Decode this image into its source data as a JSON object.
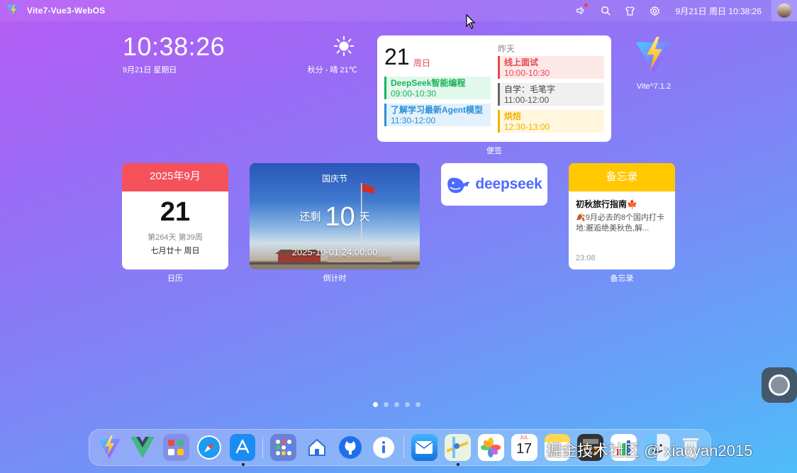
{
  "topbar": {
    "title": "Vite7-Vue3-WebOS",
    "datetime": "9月21日 周日 10:38:26",
    "icons": [
      "volume-icon",
      "search-icon",
      "shirt-icon",
      "gear-icon"
    ]
  },
  "clock": {
    "time": "10:38:26",
    "date": "9月21日 星期日"
  },
  "weather": {
    "text": "秋分 - 晴 21℃",
    "icon": "sun-icon"
  },
  "schedule": {
    "day": "21",
    "weekday": "周日",
    "yesterday": "昨天",
    "today_events": [
      {
        "title": "DeepSeek智能编程",
        "time": "09:00-10:30",
        "color": "#19b35a",
        "bg": "#e3f8ec"
      },
      {
        "title": "了解学习最新Agent模型",
        "time": "11:30-12:00",
        "color": "#2d8fd6",
        "bg": "#e2f1fb"
      }
    ],
    "yesterday_events": [
      {
        "title": "线上面试",
        "time": "10:00-10:30",
        "color": "#e5484d",
        "bg": "#fde8e8"
      },
      {
        "title": "自学：毛笔字",
        "time": "11:00-12:00",
        "color": "#666666",
        "bg": "#f0f0f0"
      },
      {
        "title": "烘焙",
        "time": "12:30-13:00",
        "color": "#f2b200",
        "bg": "#fff6dc"
      }
    ],
    "label": "便签"
  },
  "vite_app": {
    "label": "Vite^7.1.2"
  },
  "calendar": {
    "header": "2025年9月",
    "day": "21",
    "info": "第264天 第39周",
    "lunar": "七月廿十 周日",
    "label": "日历"
  },
  "countdown": {
    "festival": "国庆节",
    "prefix": "还剩",
    "number": "10",
    "suffix": "天",
    "target": "2025-10-01 24:00:00",
    "label": "倒计时"
  },
  "deepseek": {
    "text": "deepseek"
  },
  "memo": {
    "header": "备忘录",
    "title": "初秋旅行指南🍁",
    "body": "🍂9月必去的8个国内打卡地:邂逅绝美秋色,解...",
    "time": "23:08",
    "label": "备忘录"
  },
  "pager": {
    "count": 5,
    "active": 0
  },
  "dock": {
    "items": [
      {
        "icon": "vite-icon",
        "running": false
      },
      {
        "icon": "vue-icon",
        "running": false
      },
      {
        "icon": "app-folder-icon",
        "running": false
      },
      {
        "icon": "safari-icon",
        "running": false
      },
      {
        "icon": "app-store-icon",
        "running": true
      },
      {
        "icon": "launchpad-icon",
        "running": false
      },
      {
        "icon": "home-icon",
        "running": false
      },
      {
        "icon": "github-icon",
        "running": false
      },
      {
        "icon": "info-icon",
        "running": false
      },
      {
        "icon": "mail-icon",
        "running": false
      },
      {
        "icon": "maps-icon",
        "running": true
      },
      {
        "icon": "photos-icon",
        "running": false
      },
      {
        "icon": "calendar-icon",
        "running": false
      },
      {
        "icon": "notes-icon",
        "running": false
      },
      {
        "icon": "calculator-icon",
        "running": false
      },
      {
        "icon": "charts-icon",
        "running": false
      },
      {
        "icon": "finder-icon",
        "running": false
      },
      {
        "icon": "trash-icon",
        "running": false
      }
    ],
    "calendar_month": "JUL",
    "calendar_day": "17"
  },
  "watermark": "掘金技术社区 @ xiaoyan2015"
}
